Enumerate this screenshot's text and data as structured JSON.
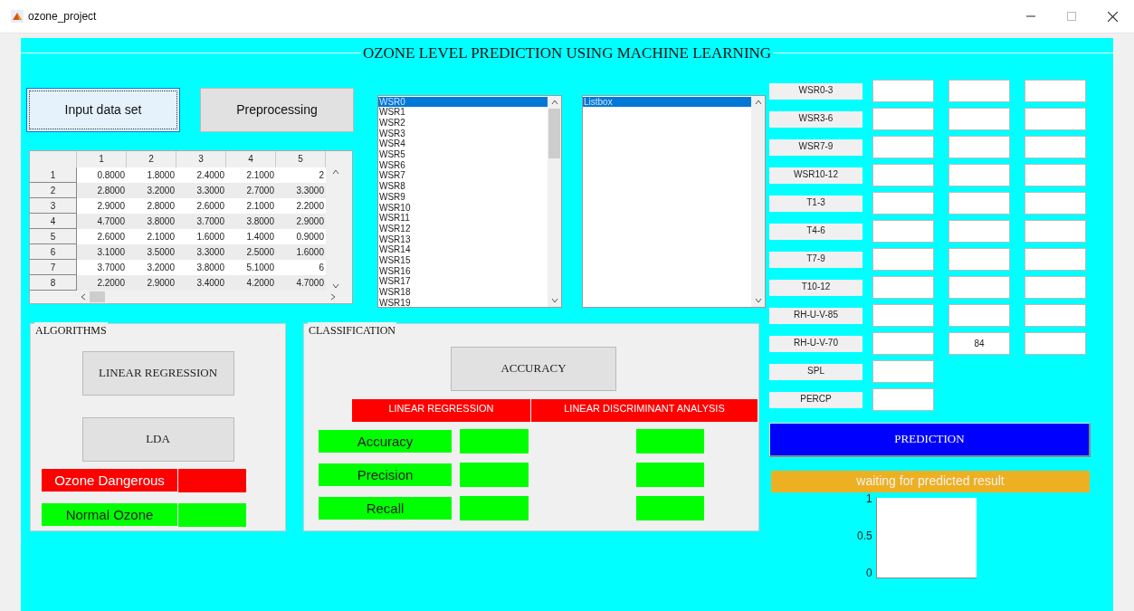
{
  "window": {
    "title": "ozone_project"
  },
  "header": {
    "title": "OZONE LEVEL PREDICTION USING MACHINE LEARNING"
  },
  "buttons": [
    {
      "label": "Input data set",
      "selected": true
    },
    {
      "label": "Preprocessing",
      "selected": false
    }
  ],
  "table": {
    "columns": [
      "1",
      "2",
      "3",
      "4",
      "5"
    ],
    "rows": [
      {
        "header": "1",
        "cells": [
          "0.8000",
          "1.8000",
          "2.4000",
          "2.1000",
          "2"
        ]
      },
      {
        "header": "2",
        "cells": [
          "2.8000",
          "3.2000",
          "3.3000",
          "2.7000",
          "3.3000"
        ]
      },
      {
        "header": "3",
        "cells": [
          "2.9000",
          "2.8000",
          "2.6000",
          "2.1000",
          "2.2000"
        ]
      },
      {
        "header": "4",
        "cells": [
          "4.7000",
          "3.8000",
          "3.7000",
          "3.8000",
          "2.9000"
        ]
      },
      {
        "header": "5",
        "cells": [
          "2.6000",
          "2.1000",
          "1.6000",
          "1.4000",
          "0.9000"
        ]
      },
      {
        "header": "6",
        "cells": [
          "3.1000",
          "3.5000",
          "3.3000",
          "2.5000",
          "1.6000"
        ]
      },
      {
        "header": "7",
        "cells": [
          "3.7000",
          "3.2000",
          "3.8000",
          "5.1000",
          "6"
        ]
      },
      {
        "header": "8",
        "cells": [
          "2.2000",
          "2.9000",
          "3.4000",
          "4.2000",
          "4.7000"
        ]
      }
    ]
  },
  "feature_list": {
    "items": [
      {
        "label": "WSR0",
        "selected": true
      },
      {
        "label": "WSR1",
        "selected": false
      },
      {
        "label": "WSR2",
        "selected": false
      },
      {
        "label": "WSR3",
        "selected": false
      },
      {
        "label": "WSR4",
        "selected": false
      },
      {
        "label": "WSR5",
        "selected": false
      },
      {
        "label": "WSR6",
        "selected": false
      },
      {
        "label": "WSR7",
        "selected": false
      },
      {
        "label": "WSR8",
        "selected": false
      },
      {
        "label": "WSR9",
        "selected": false
      },
      {
        "label": "WSR10",
        "selected": false
      },
      {
        "label": "WSR11",
        "selected": false
      },
      {
        "label": "WSR12",
        "selected": false
      },
      {
        "label": "WSR13",
        "selected": false
      },
      {
        "label": "WSR14",
        "selected": false
      },
      {
        "label": "WSR15",
        "selected": false
      },
      {
        "label": "WSR16",
        "selected": false
      },
      {
        "label": "WSR17",
        "selected": false
      },
      {
        "label": "WSR18",
        "selected": false
      },
      {
        "label": "WSR19",
        "selected": false
      }
    ]
  },
  "second_list": {
    "items": [
      {
        "label": "Listbox",
        "selected": true
      }
    ]
  },
  "inputs": [
    {
      "label": "WSR0-3",
      "fields": [
        {
          "kind": "blank"
        },
        {
          "kind": "blank"
        },
        {
          "kind": "blank"
        }
      ]
    },
    {
      "label": "WSR3-6",
      "fields": [
        {
          "kind": "blank"
        },
        {
          "kind": "blank"
        },
        {
          "kind": "blank"
        }
      ]
    },
    {
      "label": "WSR7-9",
      "fields": [
        {
          "kind": "blank"
        },
        {
          "kind": "blank"
        },
        {
          "kind": "blank"
        }
      ]
    },
    {
      "label": "WSR10-12",
      "fields": [
        {
          "kind": "blank"
        },
        {
          "kind": "blank"
        },
        {
          "kind": "blank"
        }
      ]
    },
    {
      "label": "T1-3",
      "fields": [
        {
          "kind": "blank"
        },
        {
          "kind": "blank"
        },
        {
          "kind": "blank"
        }
      ]
    },
    {
      "label": "T4-6",
      "fields": [
        {
          "kind": "blank"
        },
        {
          "kind": "blank"
        },
        {
          "kind": "blank"
        }
      ]
    },
    {
      "label": "T7-9",
      "fields": [
        {
          "kind": "blank"
        },
        {
          "kind": "blank"
        },
        {
          "kind": "blank"
        }
      ]
    },
    {
      "label": "T10-12",
      "fields": [
        {
          "kind": "blank"
        },
        {
          "kind": "blank"
        },
        {
          "kind": "blank"
        }
      ]
    },
    {
      "label": "RH-U-V-85",
      "fields": [
        {
          "kind": "blank"
        },
        {
          "kind": "blank"
        },
        {
          "kind": "blank"
        }
      ]
    },
    {
      "label": "RH-U-V-70",
      "fields": [
        {
          "kind": "blank"
        },
        {
          "kind": "filled",
          "value": "84"
        },
        {
          "kind": "blank"
        }
      ]
    },
    {
      "label": "SPL",
      "fields": [
        {
          "kind": "blank"
        }
      ]
    },
    {
      "label": "PERCP",
      "fields": [
        {
          "kind": "blank"
        }
      ]
    }
  ],
  "algorithms": {
    "title": "ALGORITHMS",
    "buttons": [
      "LINEAR REGRESSION",
      "LDA"
    ],
    "results": [
      {
        "label": "Ozone Dangerous",
        "color": "#ff0000"
      },
      {
        "label": "Normal Ozone",
        "color": "#00ff00"
      }
    ]
  },
  "classification": {
    "title": "CLASSIFICATION",
    "button": "ACCURACY",
    "methods": [
      "LINEAR REGRESSION",
      "LINEAR DISCRIMINANT ANALYSIS"
    ],
    "metrics": [
      {
        "label": "Accuracy"
      },
      {
        "label": "Precision"
      },
      {
        "label": "Recall"
      }
    ]
  },
  "prediction": {
    "button": "PREDICTION",
    "status": "waiting for predicted result"
  },
  "axes": {
    "yticks": [
      "1",
      "0.5",
      "0"
    ]
  }
}
